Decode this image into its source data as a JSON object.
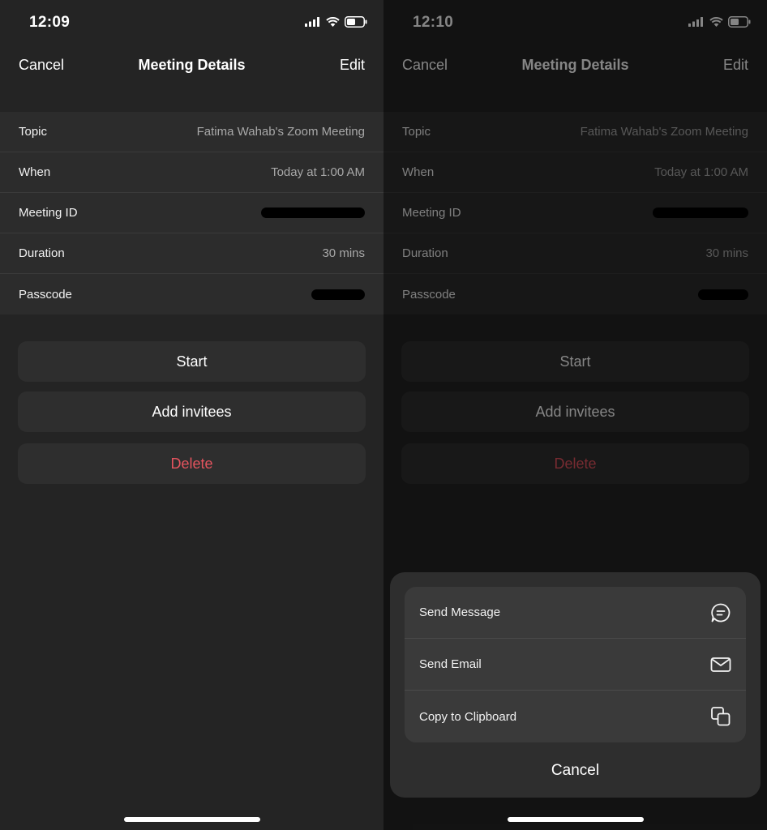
{
  "left": {
    "status_time": "12:09",
    "nav": {
      "cancel": "Cancel",
      "title": "Meeting Details",
      "edit": "Edit"
    },
    "details": [
      {
        "label": "Topic",
        "value": "Fatima Wahab's Zoom Meeting"
      },
      {
        "label": "When",
        "value": "Today at 1:00 AM"
      },
      {
        "label": "Meeting ID",
        "value": ""
      },
      {
        "label": "Duration",
        "value": "30 mins"
      },
      {
        "label": "Passcode",
        "value": ""
      }
    ],
    "buttons": {
      "start": "Start",
      "add_invitees": "Add invitees",
      "delete": "Delete"
    }
  },
  "right": {
    "status_time": "12:10",
    "nav": {
      "cancel": "Cancel",
      "title": "Meeting Details",
      "edit": "Edit"
    },
    "details": [
      {
        "label": "Topic",
        "value": "Fatima Wahab's Zoom Meeting"
      },
      {
        "label": "When",
        "value": "Today at 1:00 AM"
      },
      {
        "label": "Meeting ID",
        "value": ""
      },
      {
        "label": "Duration",
        "value": "30 mins"
      },
      {
        "label": "Passcode",
        "value": ""
      }
    ],
    "buttons": {
      "start": "Start",
      "add_invitees": "Add invitees",
      "delete": "Delete"
    },
    "share_sheet": {
      "items": [
        {
          "label": "Send Message",
          "icon": "chat-bubble-icon"
        },
        {
          "label": "Send Email",
          "icon": "envelope-icon"
        },
        {
          "label": "Copy to Clipboard",
          "icon": "copy-icon"
        }
      ],
      "cancel": "Cancel"
    }
  },
  "colors": {
    "background": "#242424",
    "delete_red": "#e5545e",
    "detail_row": "#2c2c2c"
  }
}
